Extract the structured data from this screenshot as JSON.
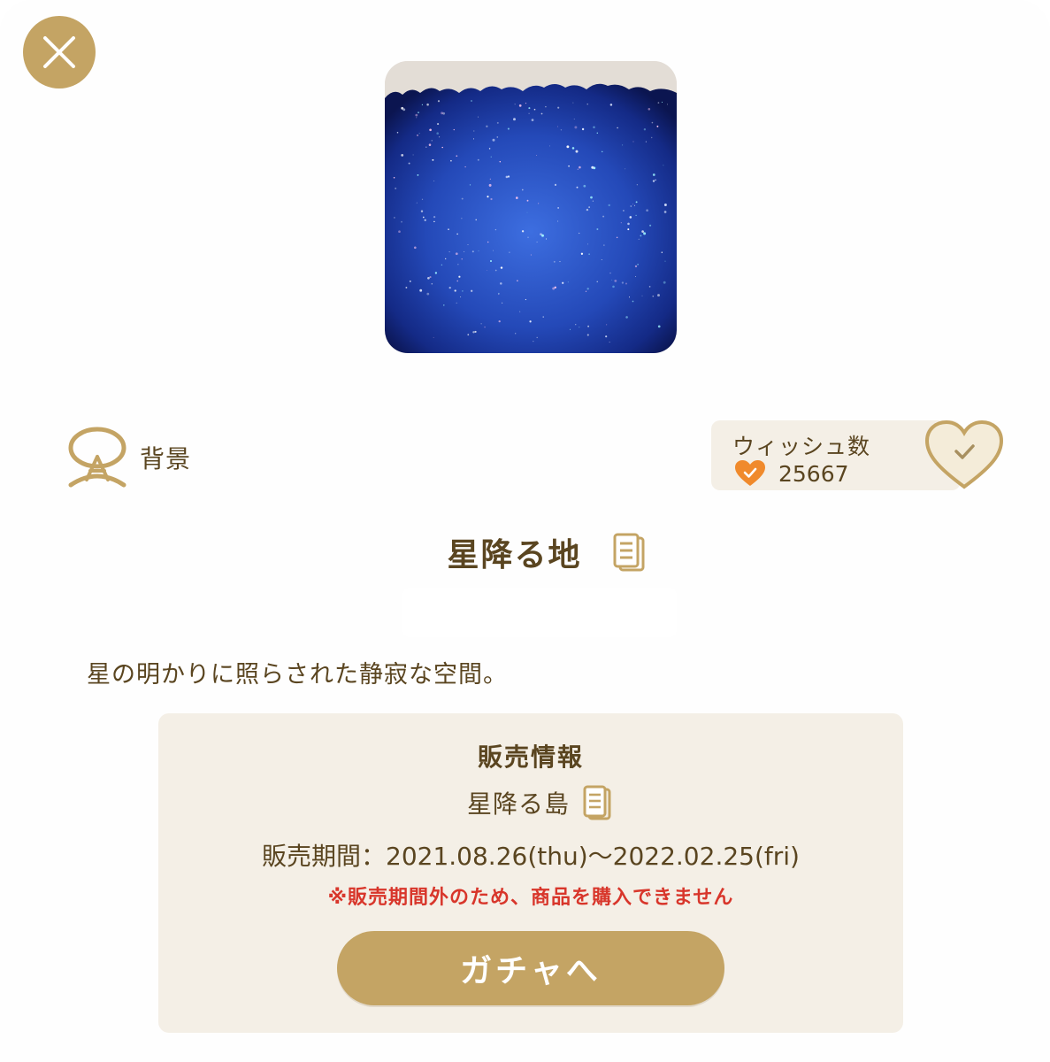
{
  "colors": {
    "accent_gold": "#c4a464",
    "text_brown": "#5a4520",
    "panel_beige": "#f4efe6",
    "warning_red": "#d8362b",
    "heart_orange": "#f08a2c"
  },
  "header": {
    "close_icon": "close-icon"
  },
  "item": {
    "image_icon": "starry-night-background",
    "category_icon": "background-category-icon",
    "category": "背景",
    "name": "星降る地",
    "description": "星の明かりに照らされた静寂な空間。"
  },
  "wish": {
    "title": "ウィッシュ数",
    "count": "25667",
    "heart_icon": "heart-check-icon"
  },
  "sales": {
    "title": "販売情報",
    "gacha_name": "星降る島",
    "period": "販売期間：2021.08.26(thu)〜2022.02.25(fri)",
    "warning": "※販売期間外のため、商品を購入できません",
    "button_label": "ガチャへ"
  }
}
